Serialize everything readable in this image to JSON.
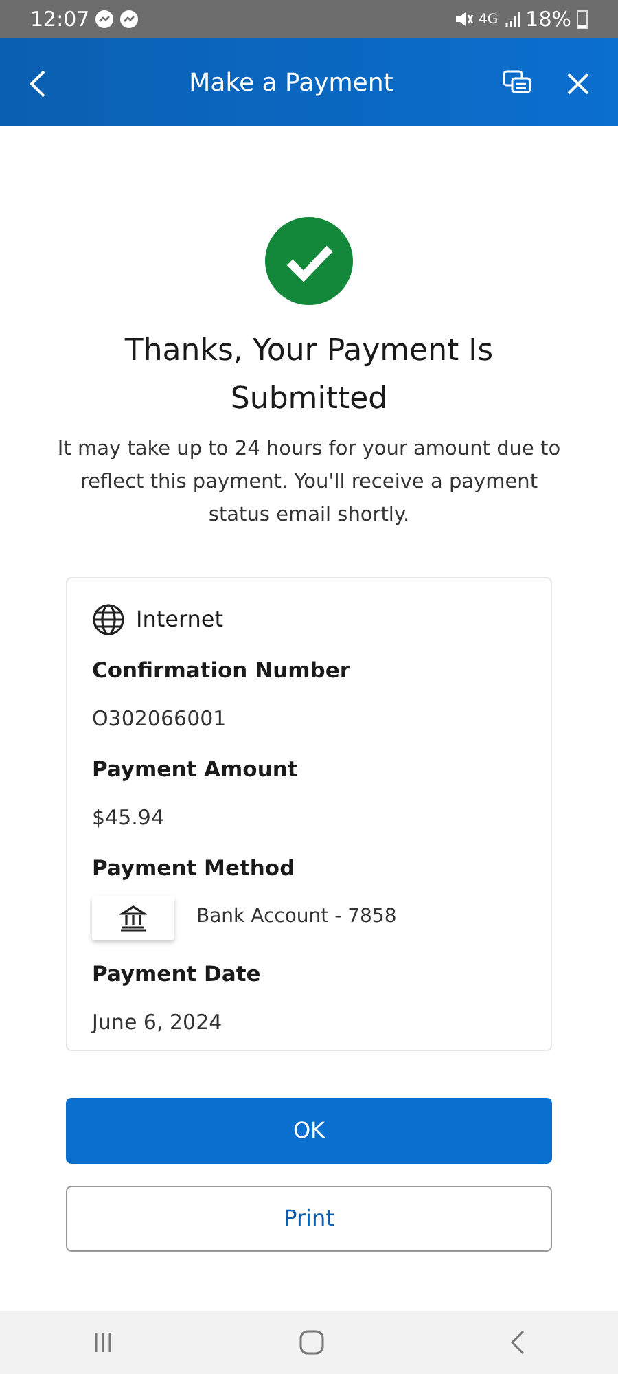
{
  "status_bar": {
    "time": "12:07",
    "network": "4G",
    "battery": "18%"
  },
  "header": {
    "title": "Make a Payment"
  },
  "confirmation": {
    "title": "Thanks, Your Payment Is Submitted",
    "message": "It may take up to 24 hours for your amount due to reflect this payment. You'll receive a payment status email shortly."
  },
  "details": {
    "service": "Internet",
    "fields": [
      {
        "kind": "text",
        "label": "Confirmation Number",
        "value": "O302066001"
      },
      {
        "kind": "text",
        "label": "Payment Amount",
        "value": "$45.94"
      },
      {
        "kind": "bank",
        "label": "Payment Method",
        "value": "Bank Account - 7858"
      },
      {
        "kind": "text",
        "label": "Payment Date",
        "value": "June 6, 2024"
      }
    ]
  },
  "buttons": [
    {
      "kind": "primary",
      "label": "OK"
    },
    {
      "kind": "outline",
      "label": "Print"
    }
  ]
}
